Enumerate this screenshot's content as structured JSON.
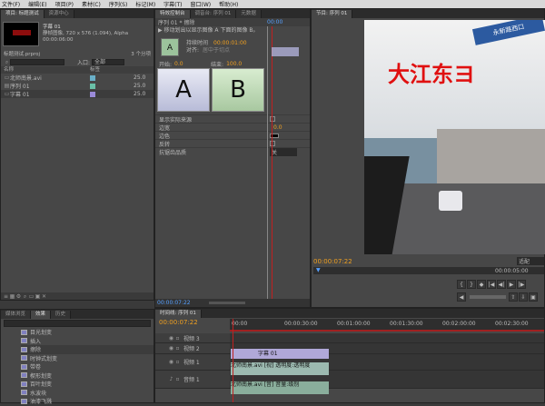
{
  "menu": [
    "文件(F)",
    "编辑(E)",
    "项目(P)",
    "素材(C)",
    "序列(S)",
    "标记(M)",
    "字幕(T)",
    "窗口(W)",
    "帮助(H)"
  ],
  "project_panel": {
    "tabs": [
      "项目: 标题测试",
      "资源中心"
    ],
    "clip_name": "字幕 01",
    "clip_info1": "静帧图像, 720 x 576 (1.094), Alpha",
    "clip_info2": "00:00:06:00",
    "project_file": "标题测试.prproj",
    "item_count": "3 个分项",
    "inlet_label": "入口:",
    "inlet_value": "全部",
    "col_name": "名称",
    "col_label": "标签",
    "items": [
      {
        "name": "北师南景.avi",
        "color": "#6ab0c8",
        "rate": "25.0"
      },
      {
        "name": "序列 01",
        "color": "#6ac0a8",
        "rate": "25.0"
      },
      {
        "name": "字幕 01",
        "color": "#9a8ad8",
        "rate": "25.0"
      }
    ]
  },
  "effects_panel": {
    "tabs": [
      "媒体浏览",
      "效果",
      "历史"
    ],
    "items": [
      "目光划变",
      "插入",
      "擦除",
      "时钟式划变",
      "带卷",
      "楔形划变",
      "百叶划变",
      "水波块",
      "油漆飞溅"
    ]
  },
  "effect_controls": {
    "tabs": [
      "特效控制台",
      "调音台: 序列 01",
      "元数据"
    ],
    "seq_label": "序列 01 * 擦除",
    "timecode_top": "00:00",
    "desc": "▶ 移动划出以显示图像 A 下面的图像 B。",
    "duration_label": "持续时间",
    "duration_value": "00:00:01:00",
    "align_label": "对齐:",
    "align_value": "居中于切点",
    "start_label": "开始:",
    "start_value": "0.0",
    "end_label": "结束:",
    "end_value": "100.0",
    "a_label": "A",
    "b_label": "B",
    "props": [
      {
        "name": "显示实际来源",
        "value": ""
      },
      {
        "name": "边宽",
        "value": "0.0"
      },
      {
        "name": "边色",
        "value": ""
      },
      {
        "name": "反转",
        "value": ""
      },
      {
        "name": "抗锯齿品质",
        "value": "关"
      }
    ],
    "bottom_timecode": "00:00:07:22"
  },
  "program_monitor": {
    "tabs": [
      "节目: 序列 01"
    ],
    "title_text": "大江东ヨ",
    "sign_text": "永新路西口",
    "timecode": "00:00:07:22",
    "fit": "适配",
    "ruler_tc": "00:00:05:00"
  },
  "timeline": {
    "tabs": [
      "时间线: 序列 01"
    ],
    "timecode": "00:00:07:22",
    "ruler": [
      "00:00",
      "00:00:30:00",
      "00:01:00:00",
      "00:01:30:00",
      "00:02:00:00",
      "00:02:30:00"
    ],
    "tracks": [
      {
        "name": "视频 3",
        "type": "video"
      },
      {
        "name": "视频 2",
        "type": "video"
      },
      {
        "name": "视频 1",
        "type": "video"
      },
      {
        "name": "音频 1",
        "type": "audio"
      }
    ],
    "clip_title": "字幕 01",
    "clip_video": "北师南景.avi [视] 透明度:透明度",
    "clip_audio": "北师南景.avi [音] 音量:级别"
  }
}
